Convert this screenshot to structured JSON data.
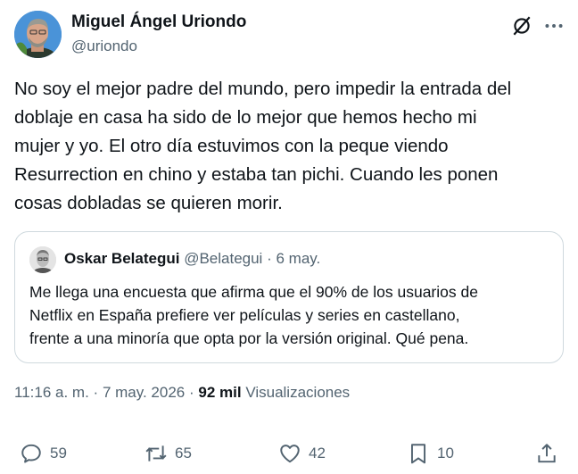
{
  "author": {
    "name": "Miguel Ángel Uriondo",
    "handle": "@uriondo"
  },
  "body": {
    "lines": [
      "No soy el mejor padre del mundo, pero impedir la entrada del",
      "doblaje en casa ha sido de lo mejor que hemos hecho mi",
      "mujer y yo. El otro día estuvimos con la peque viendo",
      "Resurrection en chino y estaba tan pichi. Cuando les ponen",
      "cosas dobladas se quieren morir."
    ]
  },
  "quote": {
    "name": "Oskar Belategui",
    "handle": "@Belategui",
    "separator": "·",
    "date": "6 may.",
    "lines": [
      "Me llega una encuesta que afirma que el 90% de los usuarios de",
      "Netflix en España prefiere ver películas y series en castellano,",
      "frente a una minoría que opta por la versión original. Qué pena."
    ]
  },
  "meta": {
    "time": "11:16 a. m.",
    "separator": "·",
    "date": "7 may. 2026",
    "views_separator": "·",
    "views_count": "92 mil",
    "views_label": "Visualizaciones"
  },
  "actions": {
    "replies": "59",
    "reposts": "65",
    "likes": "42",
    "bookmarks": "10"
  },
  "icons": {
    "grok": "grok-icon",
    "more": "more-icon",
    "reply": "reply-icon",
    "repost": "repost-icon",
    "like": "heart-icon",
    "bookmark": "bookmark-icon",
    "share": "share-icon"
  },
  "colors": {
    "text": "#0f1419",
    "secondary": "#536471",
    "border": "#cfd9de",
    "avatar_bg": "#3b8ad6"
  }
}
